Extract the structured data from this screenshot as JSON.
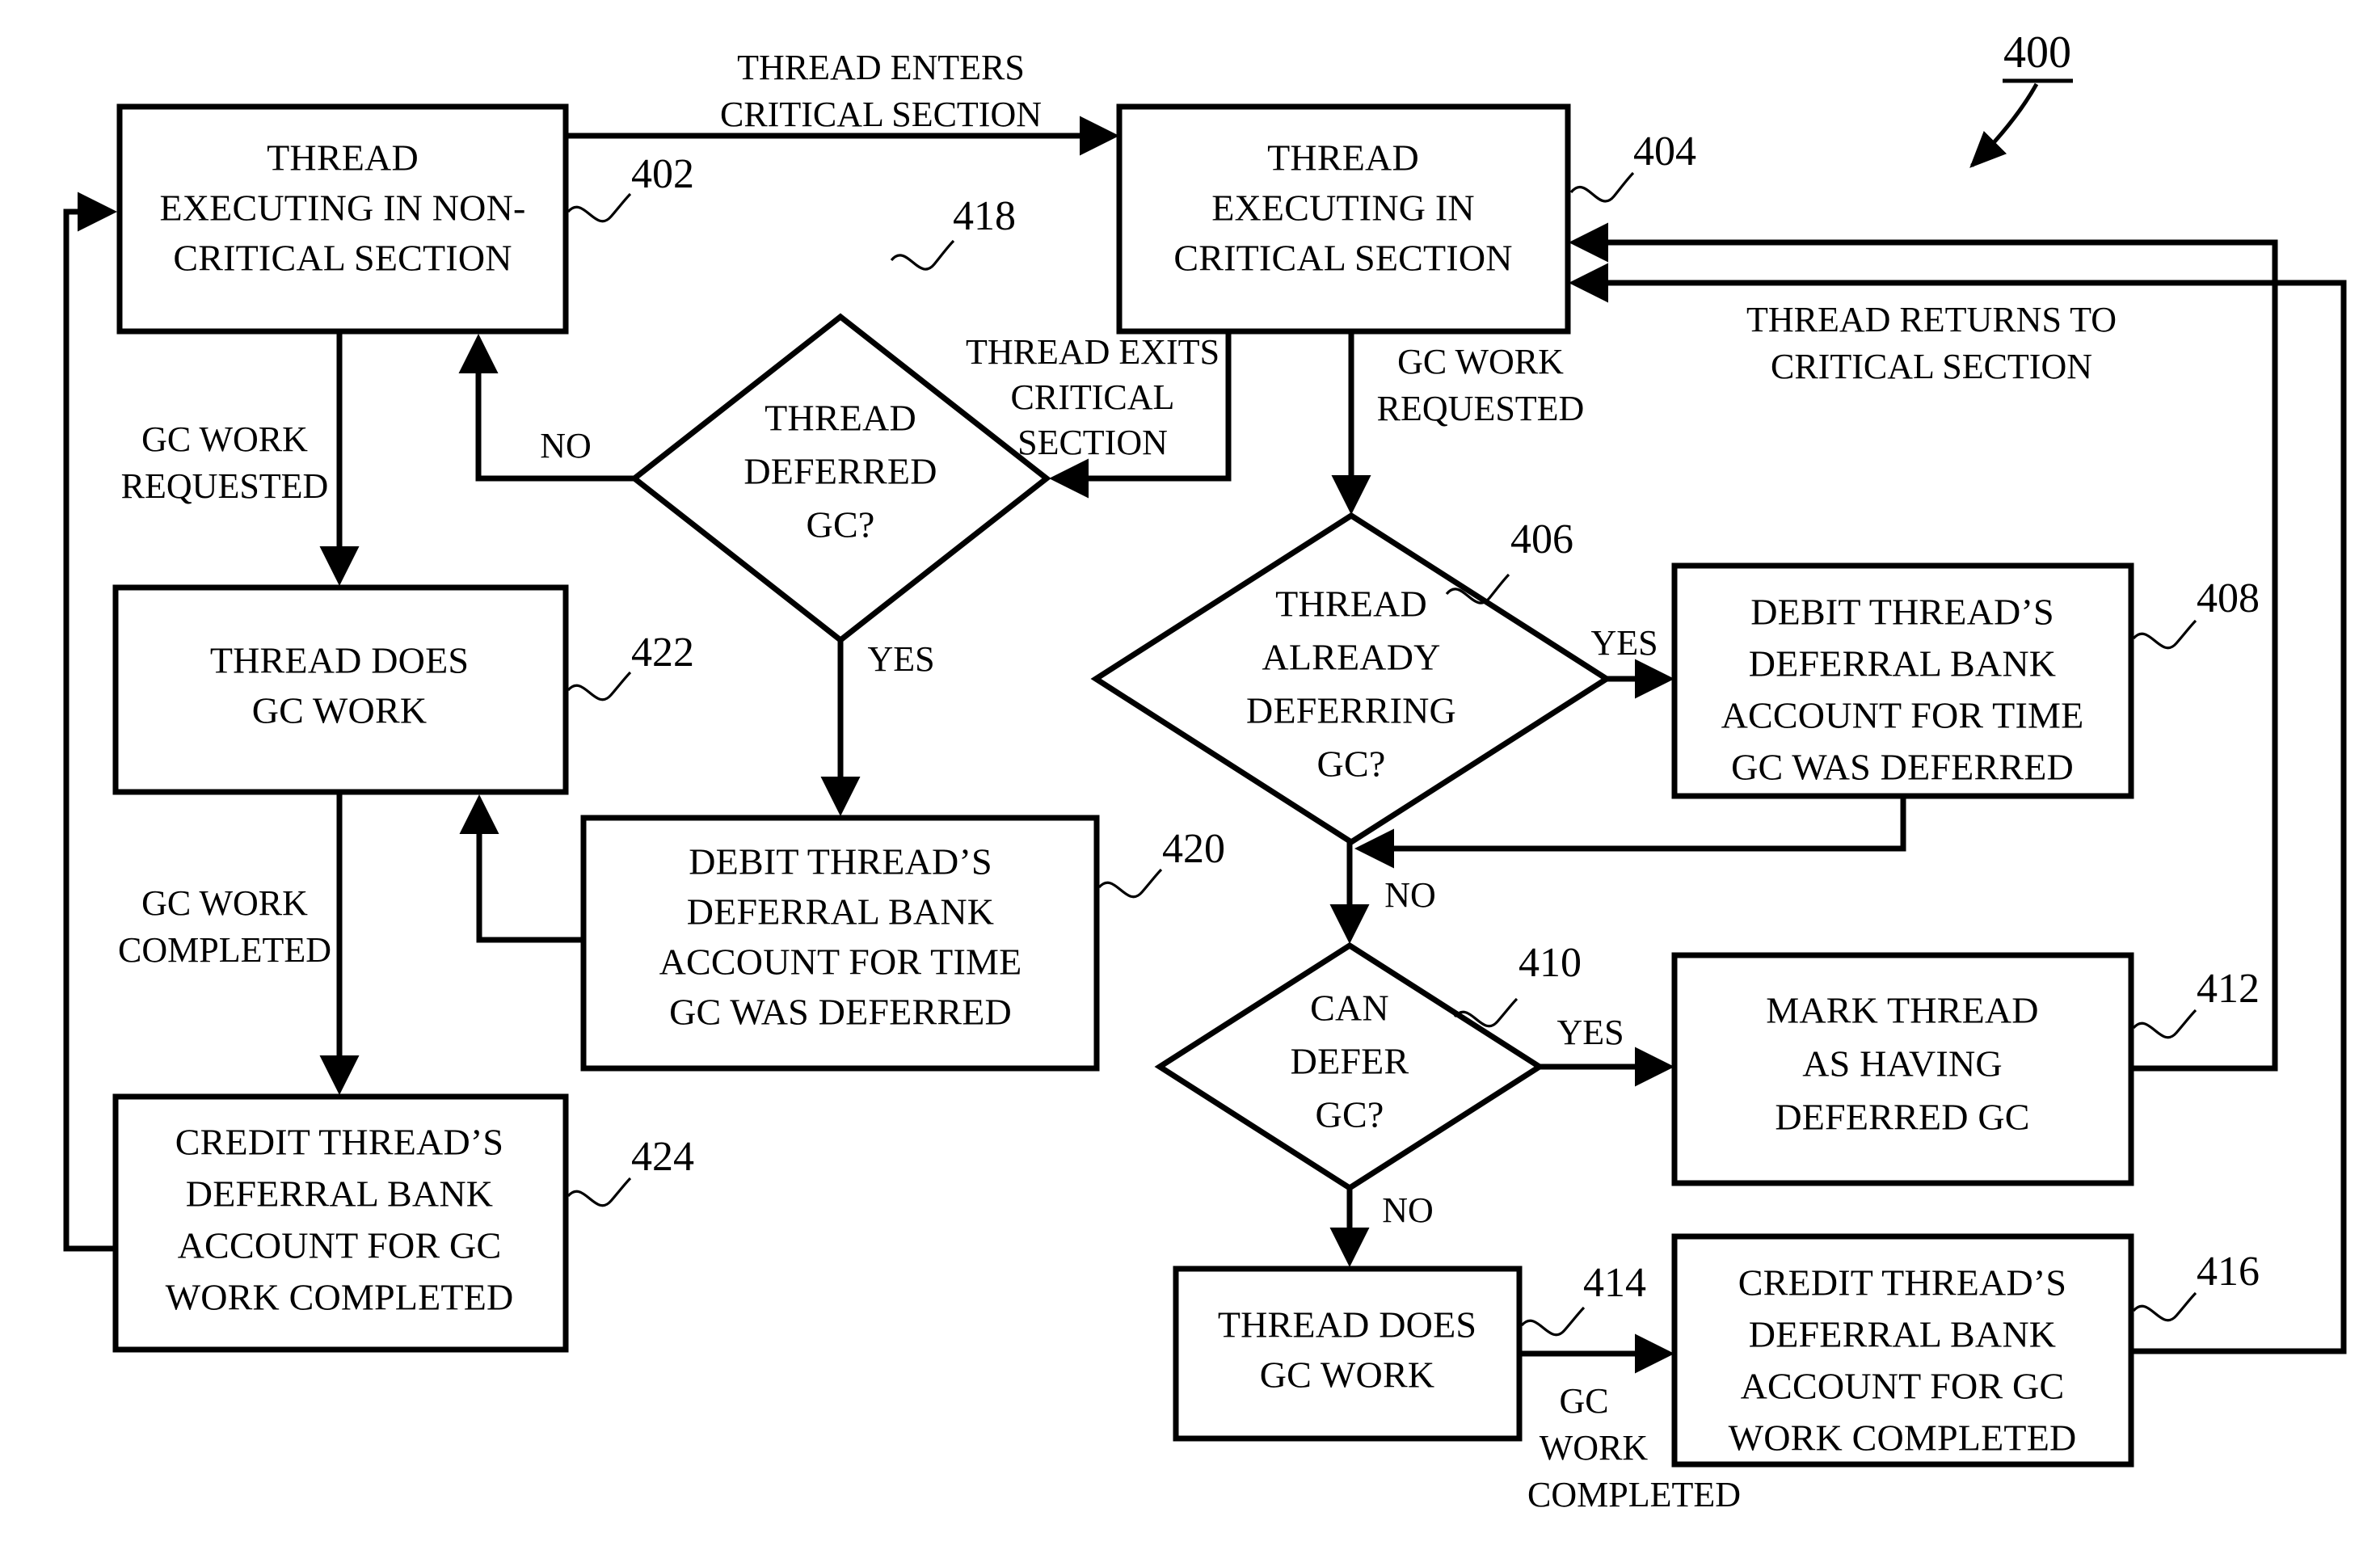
{
  "figure": {
    "number": "400",
    "nodes": [
      {
        "id": "402",
        "ref": "402",
        "shape": "process",
        "lines": [
          "THREAD",
          "EXECUTING IN NON-",
          "CRITICAL SECTION"
        ]
      },
      {
        "id": "404",
        "ref": "404",
        "shape": "process",
        "lines": [
          "THREAD",
          "EXECUTING IN",
          "CRITICAL SECTION"
        ]
      },
      {
        "id": "418",
        "ref": "418",
        "shape": "decision",
        "lines": [
          "THREAD",
          "DEFERRED",
          "GC?"
        ]
      },
      {
        "id": "422",
        "ref": "422",
        "shape": "process",
        "lines": [
          "THREAD DOES",
          "GC WORK"
        ]
      },
      {
        "id": "420",
        "ref": "420",
        "shape": "process",
        "lines": [
          "DEBIT THREAD’S",
          "DEFERRAL BANK",
          "ACCOUNT FOR TIME",
          "GC WAS DEFERRED"
        ]
      },
      {
        "id": "424",
        "ref": "424",
        "shape": "process",
        "lines": [
          "CREDIT THREAD’S",
          "DEFERRAL BANK",
          "ACCOUNT FOR GC",
          "WORK COMPLETED"
        ]
      },
      {
        "id": "406",
        "ref": "406",
        "shape": "decision",
        "lines": [
          "THREAD",
          "ALREADY",
          "DEFERRING",
          "GC?"
        ]
      },
      {
        "id": "408",
        "ref": "408",
        "shape": "process",
        "lines": [
          "DEBIT THREAD’S",
          "DEFERRAL BANK",
          "ACCOUNT FOR TIME",
          "GC WAS DEFERRED"
        ]
      },
      {
        "id": "410",
        "ref": "410",
        "shape": "decision",
        "lines": [
          "CAN",
          "DEFER",
          "GC?"
        ]
      },
      {
        "id": "412",
        "ref": "412",
        "shape": "process",
        "lines": [
          "MARK THREAD",
          "AS HAVING",
          "DEFERRED GC"
        ]
      },
      {
        "id": "414",
        "ref": "414",
        "shape": "process",
        "lines": [
          "THREAD DOES",
          "GC WORK"
        ]
      },
      {
        "id": "416",
        "ref": "416",
        "shape": "process",
        "lines": [
          "CREDIT THREAD’S",
          "DEFERRAL BANK",
          "ACCOUNT FOR GC",
          "WORK COMPLETED"
        ]
      }
    ],
    "edge_labels": [
      {
        "id": "enters",
        "lines": [
          "THREAD ENTERS",
          "CRITICAL SECTION"
        ]
      },
      {
        "id": "returns",
        "lines": [
          "THREAD RETURNS TO",
          "CRITICAL SECTION"
        ]
      },
      {
        "id": "exits",
        "lines": [
          "THREAD EXITS",
          "CRITICAL",
          "SECTION"
        ]
      },
      {
        "id": "gcreq-left",
        "lines": [
          "GC WORK",
          "REQUESTED"
        ]
      },
      {
        "id": "gcreq-404",
        "lines": [
          "GC WORK",
          "REQUESTED"
        ]
      },
      {
        "id": "gcdone-left",
        "lines": [
          "GC WORK",
          "COMPLETED"
        ]
      },
      {
        "id": "gcdone-414",
        "lines": [
          "GC",
          "WORK",
          "COMPLETED"
        ]
      },
      {
        "id": "no-418",
        "lines": [
          "NO"
        ]
      },
      {
        "id": "yes-418",
        "lines": [
          "YES"
        ]
      },
      {
        "id": "yes-406",
        "lines": [
          "YES"
        ]
      },
      {
        "id": "no-406",
        "lines": [
          "NO"
        ]
      },
      {
        "id": "yes-410",
        "lines": [
          "YES"
        ]
      },
      {
        "id": "no-410",
        "lines": [
          "NO"
        ]
      }
    ]
  }
}
